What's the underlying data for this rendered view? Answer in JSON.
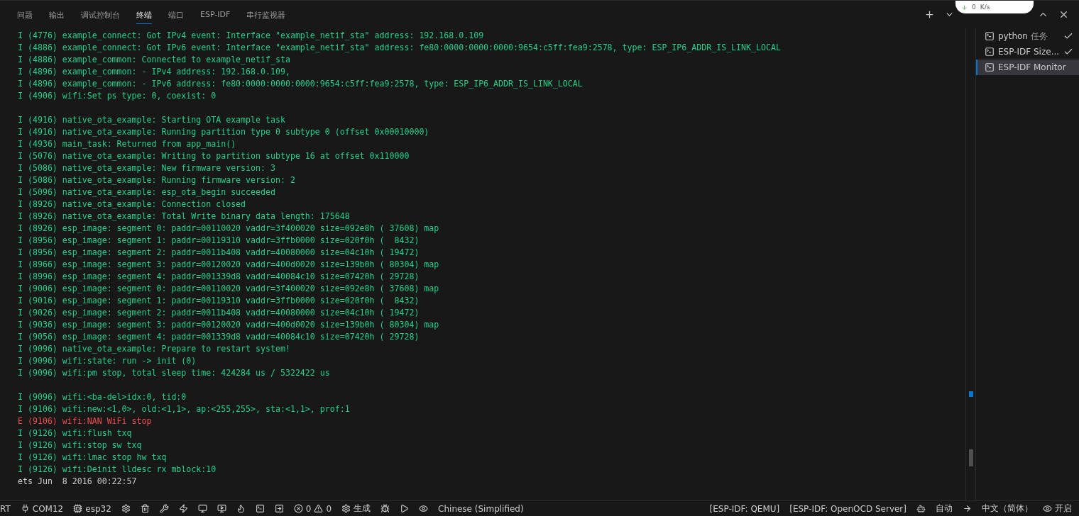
{
  "tabs": [
    {
      "label": "问题",
      "selected": false
    },
    {
      "label": "输出",
      "selected": false
    },
    {
      "label": "调试控制台",
      "selected": false
    },
    {
      "label": "终端",
      "selected": true
    },
    {
      "label": "端口",
      "selected": false
    },
    {
      "label": "ESP-IDF",
      "selected": false
    },
    {
      "label": "串行监视器",
      "selected": false
    }
  ],
  "net_widget": {
    "speed": "0",
    "unit": "K/s"
  },
  "terminal_lines": [
    {
      "kind": "info",
      "text": "I (4776) example_connect: Got IPv4 event: Interface \"example_netif_sta\" address: 192.168.0.109"
    },
    {
      "kind": "info",
      "text": "I (4886) example_connect: Got IPv6 event: Interface \"example_netif_sta\" address: fe80:0000:0000:0000:9654:c5ff:fea9:2578, type: ESP_IP6_ADDR_IS_LINK_LOCAL"
    },
    {
      "kind": "info",
      "text": "I (4886) example_common: Connected to example_netif_sta"
    },
    {
      "kind": "info",
      "text": "I (4896) example_common: - IPv4 address: 192.168.0.109,"
    },
    {
      "kind": "info",
      "text": "I (4896) example_common: - IPv6 address: fe80:0000:0000:0000:9654:c5ff:fea9:2578, type: ESP_IP6_ADDR_IS_LINK_LOCAL"
    },
    {
      "kind": "info",
      "text": "I (4906) wifi:Set ps type: 0, coexist: 0"
    },
    {
      "kind": "blank"
    },
    {
      "kind": "info",
      "text": "I (4916) native_ota_example: Starting OTA example task"
    },
    {
      "kind": "info",
      "text": "I (4916) native_ota_example: Running partition type 0 subtype 0 (offset 0x00010000)"
    },
    {
      "kind": "info",
      "text": "I (4936) main_task: Returned from app_main()"
    },
    {
      "kind": "info",
      "text": "I (5076) native_ota_example: Writing to partition subtype 16 at offset 0x110000"
    },
    {
      "kind": "info",
      "text": "I (5086) native_ota_example: New firmware version: 3"
    },
    {
      "kind": "info",
      "text": "I (5086) native_ota_example: Running firmware version: 2"
    },
    {
      "kind": "info",
      "text": "I (5096) native_ota_example: esp_ota_begin succeeded"
    },
    {
      "kind": "info",
      "text": "I (8926) native_ota_example: Connection closed"
    },
    {
      "kind": "info",
      "text": "I (8926) native_ota_example: Total Write binary data length: 175648"
    },
    {
      "kind": "info",
      "text": "I (8926) esp_image: segment 0: paddr=00110020 vaddr=3f400020 size=092e8h ( 37608) map"
    },
    {
      "kind": "info",
      "text": "I (8956) esp_image: segment 1: paddr=00119310 vaddr=3ffb0000 size=020f0h (  8432)"
    },
    {
      "kind": "info",
      "text": "I (8956) esp_image: segment 2: paddr=0011b408 vaddr=40080000 size=04c10h ( 19472)"
    },
    {
      "kind": "info",
      "text": "I (8966) esp_image: segment 3: paddr=00120020 vaddr=400d0020 size=139b0h ( 80304) map"
    },
    {
      "kind": "info",
      "text": "I (8996) esp_image: segment 4: paddr=001339d8 vaddr=40084c10 size=07420h ( 29728)"
    },
    {
      "kind": "info",
      "text": "I (9006) esp_image: segment 0: paddr=00110020 vaddr=3f400020 size=092e8h ( 37608) map"
    },
    {
      "kind": "info",
      "text": "I (9016) esp_image: segment 1: paddr=00119310 vaddr=3ffb0000 size=020f0h (  8432)"
    },
    {
      "kind": "info",
      "text": "I (9026) esp_image: segment 2: paddr=0011b408 vaddr=40080000 size=04c10h ( 19472)"
    },
    {
      "kind": "info",
      "text": "I (9036) esp_image: segment 3: paddr=00120020 vaddr=400d0020 size=139b0h ( 80304) map"
    },
    {
      "kind": "info",
      "text": "I (9056) esp_image: segment 4: paddr=001339d8 vaddr=40084c10 size=07420h ( 29728)"
    },
    {
      "kind": "info",
      "text": "I (9096) native_ota_example: Prepare to restart system!"
    },
    {
      "kind": "info",
      "text": "I (9096) wifi:state: run -> init (0)"
    },
    {
      "kind": "info",
      "text": "I (9096) wifi:pm stop, total sleep time: 424284 us / 5322422 us"
    },
    {
      "kind": "blank"
    },
    {
      "kind": "info",
      "text": "I (9096) wifi:<ba-del>idx:0, tid:0"
    },
    {
      "kind": "info",
      "text": "I (9106) wifi:new:<1,0>, old:<1,1>, ap:<255,255>, sta:<1,1>, prof:1"
    },
    {
      "kind": "error",
      "text": "E (9106) wifi:NAN WiFi stop"
    },
    {
      "kind": "info",
      "text": "I (9126) wifi:flush txq"
    },
    {
      "kind": "info",
      "text": "I (9126) wifi:stop sw txq"
    },
    {
      "kind": "info",
      "text": "I (9126) wifi:lmac stop hw txq"
    },
    {
      "kind": "info",
      "text": "I (9126) wifi:Deinit lldesc rx mblock:10"
    },
    {
      "kind": "plain",
      "text": "ets Jun  8 2016 00:22:57"
    }
  ],
  "terminals": [
    {
      "label": "python",
      "task": "任务",
      "done": true,
      "selected": false
    },
    {
      "label": "ESP-IDF Size...",
      "done": true,
      "selected": false
    },
    {
      "label": "ESP-IDF Monitor",
      "done": false,
      "selected": true
    }
  ],
  "status_left": [
    {
      "label": "RT"
    },
    {
      "label": "COM12"
    },
    {
      "label": "esp32"
    },
    {
      "errors": "0",
      "warnings": "0"
    },
    {
      "label": "生成"
    },
    {
      "label": "Chinese (Simplified)"
    }
  ],
  "status_right": [
    {
      "label": "[ESP-IDF: QEMU]"
    },
    {
      "label": "[ESP-IDF: OpenOCD Server]"
    },
    {
      "label": "自动"
    },
    {
      "label": "中文（简体）"
    },
    {
      "label": "开启"
    }
  ]
}
